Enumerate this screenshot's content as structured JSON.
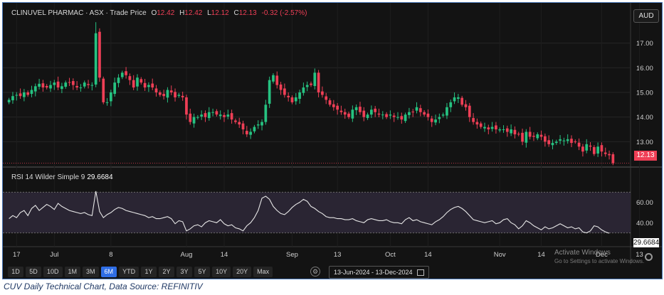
{
  "header": {
    "symbol": "CLINUVEL PHARMAC · ASX · Trade Price",
    "open_label": "O",
    "open": "12.42",
    "high_label": "H",
    "high": "12.42",
    "low_label": "L",
    "low": "12.12",
    "close_label": "C",
    "close": "12.13",
    "change": "-0.32 (-2.57%)"
  },
  "currency": "AUD",
  "last_price": "12.13",
  "rsi": {
    "label": "RSI 14 Wilder Simple 9",
    "value": "29.6684",
    "tag": "29.6684"
  },
  "toolbar": {
    "ranges": [
      "1D",
      "5D",
      "10D",
      "1M",
      "3M",
      "6M",
      "YTD",
      "1Y",
      "2Y",
      "3Y",
      "5Y",
      "10Y",
      "20Y",
      "Max"
    ],
    "active": "6M",
    "date_range": "13-Jun-2024 - 13-Dec-2024"
  },
  "watermark": {
    "line1": "Activate Windows",
    "line2": "Go to Settings to activate Windows."
  },
  "caption": "CUV Daily Technical Chart, Data Source: REFINITIV",
  "colors": {
    "up": "#26c281",
    "down": "#ef3f56",
    "rsi_line": "#e6e6e6",
    "rsi_band": "#2a2533"
  },
  "chart_data": [
    {
      "type": "candlestick",
      "ylim": [
        12.0,
        18.0
      ],
      "yticks": [
        13.0,
        14.0,
        15.0,
        16.0,
        17.0
      ],
      "x_tick_labels": [
        {
          "label": "17",
          "i": 2
        },
        {
          "label": "Jul",
          "i": 12
        },
        {
          "label": "8",
          "i": 27
        },
        {
          "label": "Aug",
          "i": 47
        },
        {
          "label": "14",
          "i": 57
        },
        {
          "label": "Sep",
          "i": 75
        },
        {
          "label": "13",
          "i": 87
        },
        {
          "label": "Oct",
          "i": 101
        },
        {
          "label": "14",
          "i": 111
        },
        {
          "label": "Nov",
          "i": 130
        },
        {
          "label": "14",
          "i": 141
        },
        {
          "label": "Dec",
          "i": 157
        },
        {
          "label": "13",
          "i": 167
        }
      ],
      "close": [
        14.7,
        14.85,
        14.9,
        14.85,
        15.0,
        14.9,
        15.1,
        15.25,
        15.35,
        15.2,
        15.2,
        15.3,
        15.4,
        15.2,
        15.25,
        15.4,
        15.4,
        15.3,
        15.2,
        15.2,
        15.4,
        15.3,
        15.3,
        17.4,
        15.6,
        14.6,
        14.6,
        15.0,
        15.4,
        15.6,
        15.8,
        15.7,
        15.5,
        15.2,
        15.6,
        15.4,
        15.2,
        15.3,
        15.2,
        15.0,
        14.9,
        14.85,
        15.1,
        15.0,
        14.8,
        14.9,
        14.8,
        14.1,
        13.8,
        14.0,
        14.0,
        14.1,
        14.0,
        14.2,
        14.2,
        14.1,
        14.1,
        14.0,
        14.1,
        13.9,
        13.8,
        13.7,
        13.5,
        13.3,
        13.4,
        13.6,
        13.7,
        13.8,
        14.5,
        15.5,
        15.7,
        15.3,
        15.1,
        14.9,
        14.8,
        14.6,
        14.8,
        15.0,
        15.2,
        15.3,
        15.3,
        15.8,
        15.0,
        14.9,
        14.7,
        14.5,
        14.4,
        14.3,
        14.2,
        14.1,
        14.0,
        14.3,
        14.4,
        14.2,
        14.0,
        14.1,
        14.3,
        14.2,
        14.1,
        14.1,
        14.0,
        14.1,
        14.0,
        14.0,
        13.9,
        14.1,
        14.2,
        14.2,
        14.4,
        14.2,
        14.1,
        14.0,
        13.8,
        13.9,
        14.0,
        14.1,
        14.4,
        14.6,
        14.8,
        14.8,
        14.5,
        14.4,
        14.0,
        13.8,
        13.7,
        13.6,
        13.6,
        13.5,
        13.6,
        13.5,
        13.5,
        13.5,
        13.4,
        13.5,
        13.3,
        13.3,
        13.0,
        13.4,
        13.2,
        13.2,
        13.3,
        13.2,
        13.0,
        12.9,
        12.95,
        13.0,
        13.1,
        13.05,
        13.1,
        12.95,
        13.0,
        12.8,
        12.6,
        12.9,
        12.8,
        12.5,
        12.8,
        12.6,
        12.5,
        12.45,
        12.13
      ],
      "open_offsets": "computed by renderer",
      "last_price": 12.13
    },
    {
      "type": "line",
      "name": "RSI 14 Wilder Simple 9",
      "ylim": [
        20,
        80
      ],
      "yticks": [
        40,
        60
      ],
      "band": [
        30,
        70
      ],
      "values": [
        44,
        47,
        45,
        50,
        52,
        47,
        54,
        57,
        52,
        55,
        58,
        56,
        53,
        59,
        56,
        54,
        52,
        51,
        50,
        49,
        50,
        48,
        47,
        71,
        51,
        45,
        48,
        50,
        53,
        55,
        54,
        52,
        51,
        50,
        49,
        48,
        47,
        45,
        46,
        44,
        44,
        45,
        46,
        44,
        39,
        42,
        41,
        32,
        34,
        37,
        38,
        36,
        40,
        42,
        41,
        40,
        43,
        39,
        37,
        38,
        35,
        34,
        32,
        37,
        40,
        45,
        52,
        64,
        66,
        63,
        56,
        52,
        49,
        48,
        51,
        55,
        58,
        60,
        63,
        61,
        56,
        54,
        51,
        49,
        46,
        45,
        45,
        44,
        44,
        43,
        43,
        44,
        42,
        41,
        40,
        43,
        44,
        43,
        42,
        42,
        43,
        41,
        40,
        40,
        39,
        43,
        45,
        42,
        43,
        41,
        40,
        39,
        38,
        41,
        43,
        46,
        50,
        53,
        55,
        56,
        54,
        51,
        47,
        43,
        42,
        41,
        40,
        41,
        42,
        39,
        40,
        43,
        44,
        40,
        38,
        34,
        37,
        42,
        40,
        37,
        35,
        33,
        36,
        34,
        35,
        37,
        39,
        37,
        35,
        36,
        34,
        35,
        31,
        30,
        32,
        37,
        36,
        33,
        31,
        29.7
      ]
    }
  ]
}
